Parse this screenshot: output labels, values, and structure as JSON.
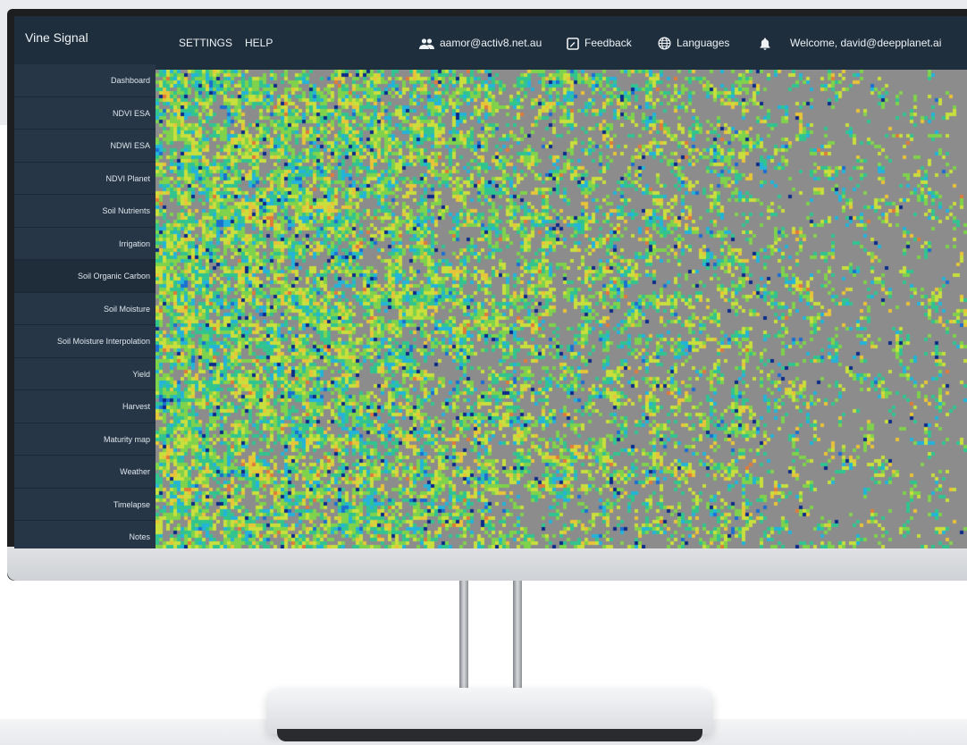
{
  "app": {
    "title": "Vine Signal"
  },
  "sidebar": {
    "items": [
      {
        "label": "Dashboard"
      },
      {
        "label": "NDVI ESA"
      },
      {
        "label": "NDWI ESA"
      },
      {
        "label": "NDVI Planet"
      },
      {
        "label": "Soil Nutrients"
      },
      {
        "label": "Irrigation"
      },
      {
        "label": "Soil Organic Carbon",
        "active": true
      },
      {
        "label": "Soil Moisture"
      },
      {
        "label": "Soil Moisture Interpolation"
      },
      {
        "label": "Yield"
      },
      {
        "label": "Harvest"
      },
      {
        "label": "Maturity map"
      },
      {
        "label": "Weather"
      },
      {
        "label": "Timelapse"
      },
      {
        "label": "Notes"
      }
    ]
  },
  "topbar": {
    "settings": "SETTINGS",
    "help": "HELP",
    "account": "aamor@activ8.net.au",
    "feedback": "Feedback",
    "languages": "Languages",
    "welcome": "Welcome, david@deepplanet.ai"
  },
  "icons": {
    "account": "users-icon",
    "feedback": "feedback-icon",
    "languages": "globe-icon",
    "notifications": "bell-icon"
  },
  "colors": {
    "sidebar": "#263646",
    "topbar": "#1f2e3d",
    "map_background": "#8c8c8c",
    "map_palette": [
      "#0d2a8a",
      "#1c6fd1",
      "#25b4d9",
      "#32c48f",
      "#7fd24b",
      "#c9df3d",
      "#e8c43a",
      "#e07a3a"
    ]
  }
}
